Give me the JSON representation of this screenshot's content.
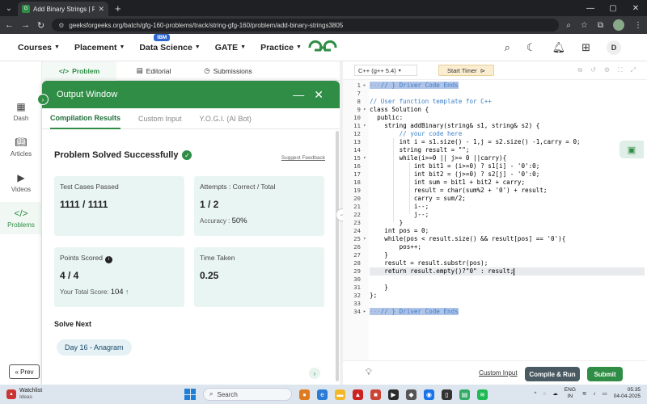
{
  "browser": {
    "tab_title": "Add Binary Strings | Practice | G",
    "new_tab": "+",
    "url": "geeksforgeeks.org/batch/gfg-160-problems/track/string-gfg-160/problem/add-binary-strings3805"
  },
  "header": {
    "nav": [
      {
        "label": "Courses"
      },
      {
        "label": "Placement"
      },
      {
        "label": "Data Science"
      },
      {
        "label": "GATE"
      },
      {
        "label": "Practice"
      }
    ],
    "badge": "IBM",
    "avatar": "D"
  },
  "rail": {
    "items": [
      {
        "label": "Dash"
      },
      {
        "label": "Articles"
      },
      {
        "label": "Videos"
      },
      {
        "label": "Problems"
      }
    ],
    "prev": "« Prev"
  },
  "panel_tabs": [
    "Problem",
    "Editorial",
    "Submissions"
  ],
  "output": {
    "title": "Output Window",
    "tabs": [
      "Compilation Results",
      "Custom Input",
      "Y.O.G.I. (AI Bot)"
    ],
    "status": "Problem Solved Successfully",
    "feedback": "Suggest Feedback",
    "cards": {
      "tests_label": "Test Cases Passed",
      "tests_value": "1111 / 1111",
      "attempts_label": "Attempts : Correct / Total",
      "attempts_value": "1 / 2",
      "accuracy_label": "Accuracy :",
      "accuracy_value": "50%",
      "points_label": "Points Scored",
      "points_value": "4 / 4",
      "total_label": "Your Total Score:",
      "total_value": "104",
      "time_label": "Time Taken",
      "time_value": "0.25"
    },
    "solve_next": "Solve Next",
    "next_problem": "Day 16 - Anagram"
  },
  "editor": {
    "language": "C++ (g++ 5.4)",
    "timer": "Start Timer",
    "lines": [
      {
        "n": "1",
        "text": "// } Driver Code Ends",
        "fold": "›",
        "sel": true
      },
      {
        "n": "7",
        "text": ""
      },
      {
        "n": "8",
        "text": "// User function template for C++"
      },
      {
        "n": "9",
        "text": "class Solution {",
        "fold": "⌄"
      },
      {
        "n": "10",
        "text": "  public:"
      },
      {
        "n": "11",
        "text": "    string addBinary(string& s1, string& s2) {",
        "fold": "⌄"
      },
      {
        "n": "12",
        "text": "        // your code here"
      },
      {
        "n": "13",
        "text": "        int i = s1.size() - 1,j = s2.size() -1,carry = 0;"
      },
      {
        "n": "14",
        "text": "        string result = \"\";"
      },
      {
        "n": "15",
        "text": "        while(i>=0 || j>= 0 ||carry){",
        "fold": "⌄"
      },
      {
        "n": "16",
        "text": "            int bit1 = (i>=0) ? s1[i] - '0':0;"
      },
      {
        "n": "17",
        "text": "            int bit2 = (j>=0) ? s2[j] - '0':0;"
      },
      {
        "n": "18",
        "text": "            int sum = bit1 + bit2 + carry;"
      },
      {
        "n": "19",
        "text": "            result = char(sum%2 + '0') + result;"
      },
      {
        "n": "20",
        "text": "            carry = sum/2;"
      },
      {
        "n": "21",
        "text": "            i--;"
      },
      {
        "n": "22",
        "text": "            j--;"
      },
      {
        "n": "23",
        "text": "        }"
      },
      {
        "n": "24",
        "text": "    int pos = 0;"
      },
      {
        "n": "25",
        "text": "    while(pos < result.size() && result[pos] == '0'){",
        "fold": "⌄"
      },
      {
        "n": "26",
        "text": "        pos++;"
      },
      {
        "n": "27",
        "text": "    }"
      },
      {
        "n": "28",
        "text": "    result = result.substr(pos);"
      },
      {
        "n": "29",
        "text": "    return result.empty()?\"0\" : result;",
        "hl": true
      },
      {
        "n": "30",
        "text": ""
      },
      {
        "n": "31",
        "text": "    }"
      },
      {
        "n": "32",
        "text": "};"
      },
      {
        "n": "33",
        "text": ""
      },
      {
        "n": "34",
        "text": "// } Driver Code Ends",
        "fold": "›",
        "sel": true
      }
    ],
    "custom_input": "Custom Input",
    "run": "Compile & Run",
    "submit": "Submit"
  },
  "taskbar": {
    "watchlist": "Watchlist",
    "ideas": "Ideas",
    "search": "Search",
    "lang1": "ENG",
    "lang2": "IN",
    "time": "05:35",
    "date": "04-04-2025"
  },
  "colors": {
    "brand": "#2f8d46",
    "card": "#e9f5f3",
    "run": "#4a5a63"
  }
}
